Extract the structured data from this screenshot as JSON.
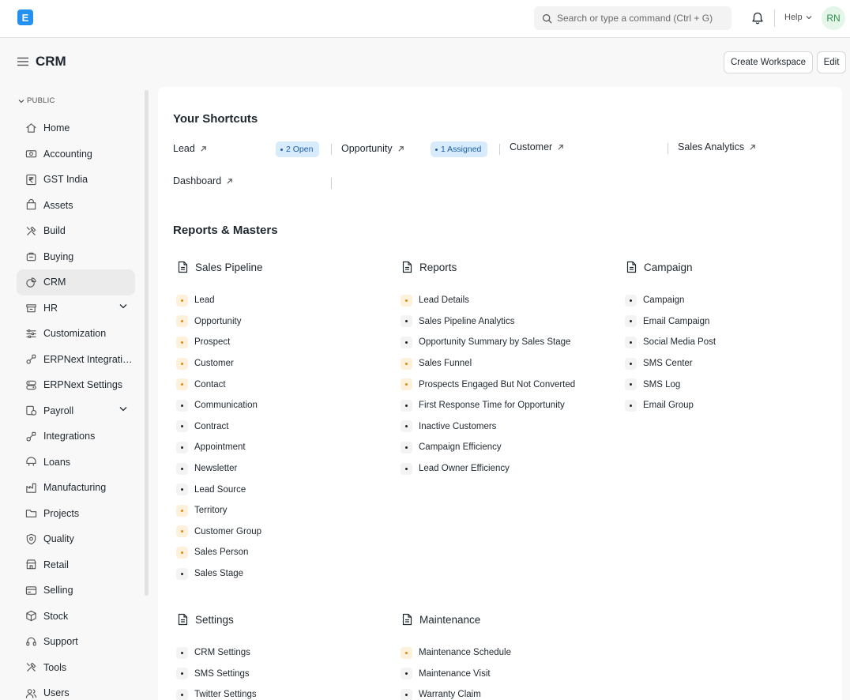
{
  "brand": {
    "logo_letter": "E",
    "color": "#2490ef"
  },
  "navbar": {
    "search_placeholder": "Search or type a command (Ctrl + G)",
    "help_label": "Help",
    "avatar_initials": "RN"
  },
  "header": {
    "title": "CRM",
    "create_workspace_label": "Create Workspace",
    "edit_label": "Edit"
  },
  "sidebar": {
    "section_label": "PUBLIC",
    "items": [
      {
        "label": "Home",
        "icon": "home-icon"
      },
      {
        "label": "Accounting",
        "icon": "accounting-icon"
      },
      {
        "label": "GST India",
        "icon": "rupee-icon"
      },
      {
        "label": "Assets",
        "icon": "assets-icon"
      },
      {
        "label": "Build",
        "icon": "tools-icon"
      },
      {
        "label": "Buying",
        "icon": "buying-icon"
      },
      {
        "label": "CRM",
        "icon": "crm-icon",
        "active": true
      },
      {
        "label": "HR",
        "icon": "hr-icon",
        "expandable": true
      },
      {
        "label": "Customization",
        "icon": "sliders-icon"
      },
      {
        "label": "ERPNext Integratio...",
        "icon": "integration-icon"
      },
      {
        "label": "ERPNext Settings",
        "icon": "settings-icon"
      },
      {
        "label": "Payroll",
        "icon": "payroll-icon",
        "expandable": true
      },
      {
        "label": "Integrations",
        "icon": "integration-icon"
      },
      {
        "label": "Loans",
        "icon": "loans-icon"
      },
      {
        "label": "Manufacturing",
        "icon": "manufacturing-icon"
      },
      {
        "label": "Projects",
        "icon": "folder-icon"
      },
      {
        "label": "Quality",
        "icon": "quality-icon"
      },
      {
        "label": "Retail",
        "icon": "retail-icon"
      },
      {
        "label": "Selling",
        "icon": "selling-icon"
      },
      {
        "label": "Stock",
        "icon": "stock-icon"
      },
      {
        "label": "Support",
        "icon": "support-icon"
      },
      {
        "label": "Tools",
        "icon": "tools-icon"
      },
      {
        "label": "Users",
        "icon": "users-icon"
      }
    ]
  },
  "shortcuts": {
    "title": "Your Shortcuts",
    "items": [
      {
        "label": "Lead",
        "badge": "2 Open"
      },
      {
        "label": "Opportunity",
        "badge": "1 Assigned"
      },
      {
        "label": "Customer"
      },
      {
        "label": "Sales Analytics"
      },
      {
        "label": "Dashboard"
      }
    ]
  },
  "reports": {
    "title": "Reports & Masters",
    "cards": [
      {
        "title": "Sales Pipeline",
        "links": [
          {
            "label": "Lead",
            "warn": true
          },
          {
            "label": "Opportunity",
            "warn": true
          },
          {
            "label": "Prospect",
            "warn": true
          },
          {
            "label": "Customer",
            "warn": true
          },
          {
            "label": "Contact",
            "warn": true
          },
          {
            "label": "Communication",
            "warn": false
          },
          {
            "label": "Contract",
            "warn": false
          },
          {
            "label": "Appointment",
            "warn": false
          },
          {
            "label": "Newsletter",
            "warn": false
          },
          {
            "label": "Lead Source",
            "warn": false
          },
          {
            "label": "Territory",
            "warn": true
          },
          {
            "label": "Customer Group",
            "warn": true
          },
          {
            "label": "Sales Person",
            "warn": true
          },
          {
            "label": "Sales Stage",
            "warn": false
          }
        ]
      },
      {
        "title": "Reports",
        "links": [
          {
            "label": "Lead Details",
            "warn": true
          },
          {
            "label": "Sales Pipeline Analytics",
            "warn": false
          },
          {
            "label": "Opportunity Summary by Sales Stage",
            "warn": false
          },
          {
            "label": "Sales Funnel",
            "warn": true
          },
          {
            "label": "Prospects Engaged But Not Converted",
            "warn": true
          },
          {
            "label": "First Response Time for Opportunity",
            "warn": false
          },
          {
            "label": "Inactive Customers",
            "warn": false
          },
          {
            "label": "Campaign Efficiency",
            "warn": false
          },
          {
            "label": "Lead Owner Efficiency",
            "warn": false
          }
        ]
      },
      {
        "title": "Campaign",
        "links": [
          {
            "label": "Campaign",
            "warn": false
          },
          {
            "label": "Email Campaign",
            "warn": false
          },
          {
            "label": "Social Media Post",
            "warn": false
          },
          {
            "label": "SMS Center",
            "warn": false
          },
          {
            "label": "SMS Log",
            "warn": false
          },
          {
            "label": "Email Group",
            "warn": false
          }
        ]
      },
      {
        "title": "Settings",
        "links": [
          {
            "label": "CRM Settings",
            "warn": false
          },
          {
            "label": "SMS Settings",
            "warn": false
          },
          {
            "label": "Twitter Settings",
            "warn": false
          }
        ]
      },
      {
        "title": "Maintenance",
        "links": [
          {
            "label": "Maintenance Schedule",
            "warn": true
          },
          {
            "label": "Maintenance Visit",
            "warn": false
          },
          {
            "label": "Warranty Claim",
            "warn": false
          }
        ]
      }
    ]
  }
}
